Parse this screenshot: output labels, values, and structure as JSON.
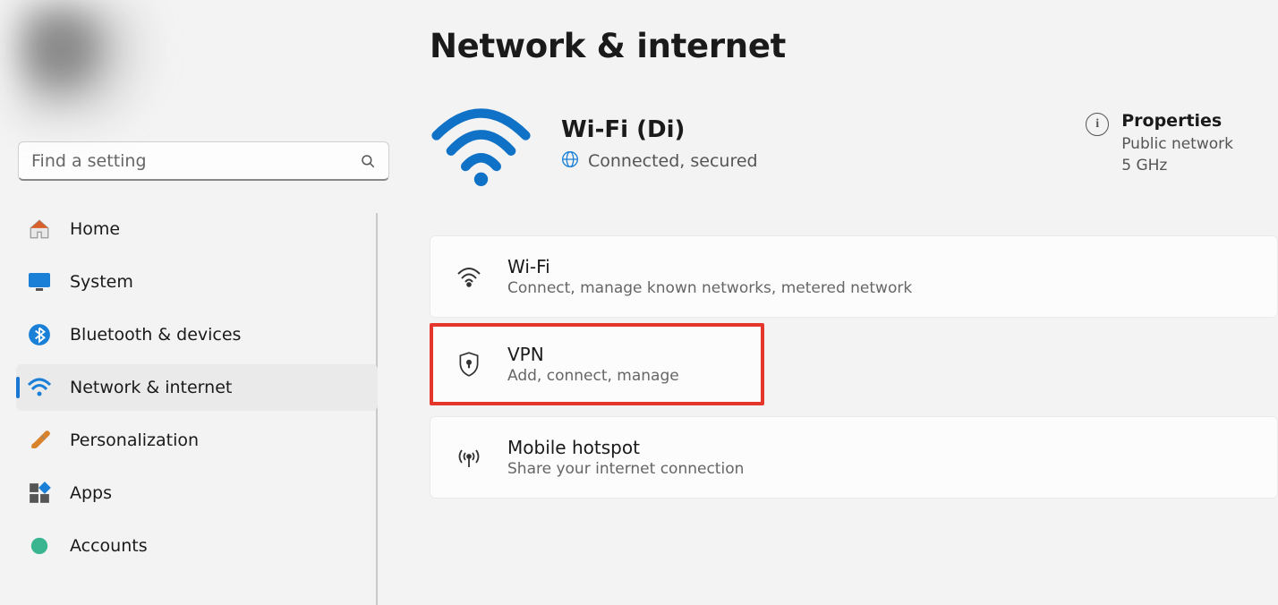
{
  "search": {
    "placeholder": "Find a setting"
  },
  "sidebar": {
    "items": [
      {
        "label": "Home"
      },
      {
        "label": "System"
      },
      {
        "label": "Bluetooth & devices"
      },
      {
        "label": "Network & internet"
      },
      {
        "label": "Personalization"
      },
      {
        "label": "Apps"
      },
      {
        "label": "Accounts"
      }
    ]
  },
  "page": {
    "title": "Network & internet",
    "status": {
      "name": "Wi-Fi (Di)",
      "detail": "Connected, secured"
    },
    "properties": {
      "title": "Properties",
      "line1": "Public network",
      "line2": "5 GHz"
    },
    "options": [
      {
        "title": "Wi-Fi",
        "sub": "Connect, manage known networks, metered network"
      },
      {
        "title": "VPN",
        "sub": "Add, connect, manage"
      },
      {
        "title": "Mobile hotspot",
        "sub": "Share your internet connection"
      }
    ]
  }
}
